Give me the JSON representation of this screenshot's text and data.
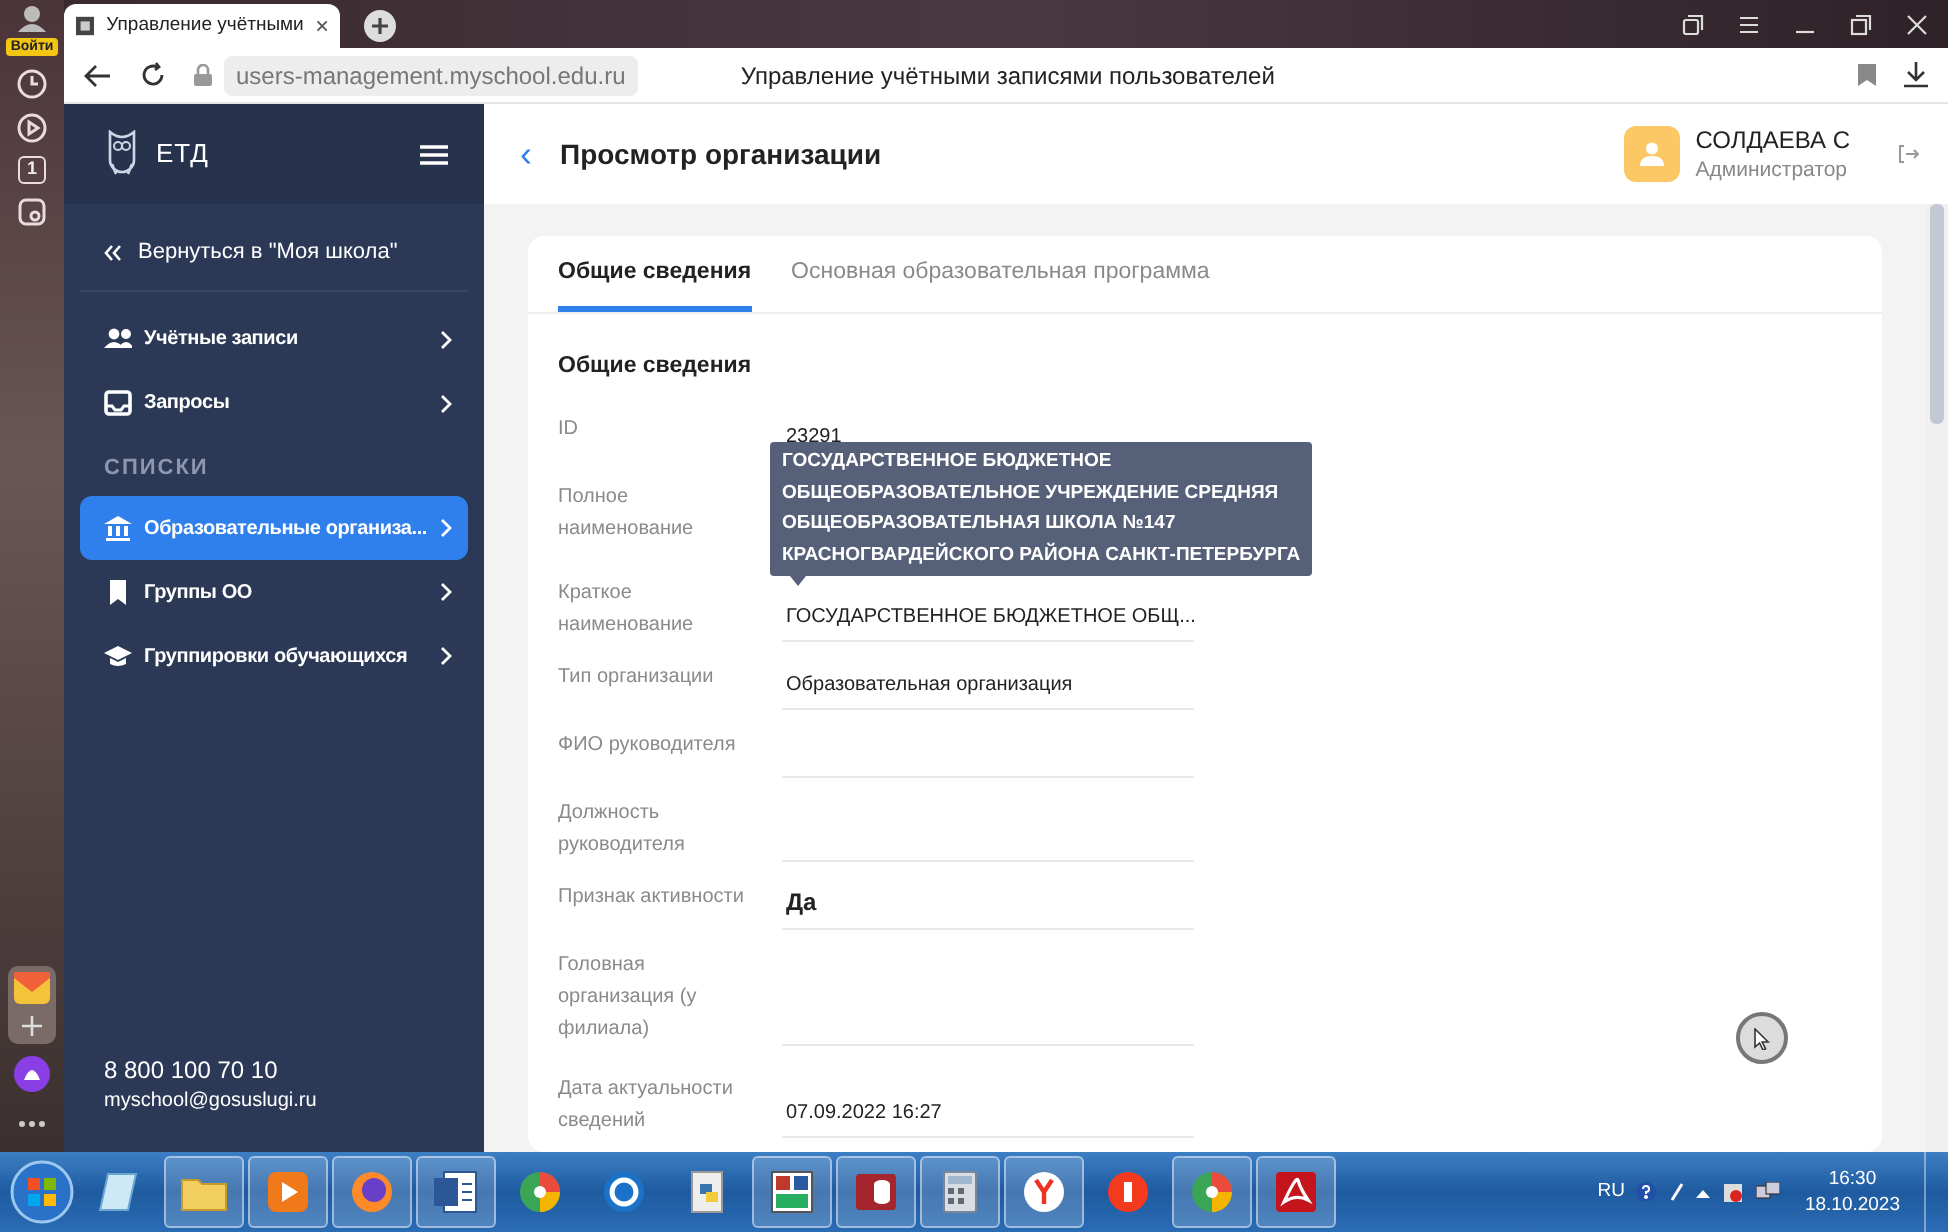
{
  "browser": {
    "login_label": "Войти",
    "badge_number": "1",
    "tab_title": "Управление учётными",
    "url": "users-management.myschool.edu.ru",
    "page_title": "Управление учётными записями пользователей"
  },
  "sidebar": {
    "logo": "ЕТД",
    "back_link": "Вернуться в \"Моя школа\"",
    "items": [
      {
        "label": "Учётные записи",
        "selected": false
      },
      {
        "label": "Запросы",
        "selected": false
      }
    ],
    "lists_section": {
      "title": "СПИСКИ",
      "items": [
        {
          "label": "Образовательные организа...",
          "selected": true
        },
        {
          "label": "Группы ОО",
          "selected": false
        },
        {
          "label": "Группировки обучающихся",
          "selected": false
        }
      ]
    },
    "phone": "8 800 100 70 10",
    "email": "myschool@gosuslugi.ru"
  },
  "header": {
    "back": "‹",
    "title": "Просмотр организации",
    "user_name": "СОЛДАЕВА С",
    "user_role": "Администратор"
  },
  "tabs": [
    {
      "label": "Общие сведения",
      "selected": true
    },
    {
      "label": "Основная образовательная программа",
      "selected": false
    }
  ],
  "section_title": "Общие сведения",
  "fields": [
    {
      "label": "ID",
      "value": "23291"
    },
    {
      "label": "Полное наименование"
    },
    {
      "label": "Краткое наименование",
      "value": "ГОСУДАРСТВЕННОЕ БЮДЖЕТНОЕ ОБЩ..."
    },
    {
      "label": "Тип организации",
      "value": "Образовательная организация"
    },
    {
      "label": "ФИО руководителя"
    },
    {
      "label": "Должность руководителя"
    },
    {
      "label": "Признак активности",
      "value": "Да"
    },
    {
      "label": "Головная организация (у филиала)"
    },
    {
      "label": "Дата актуальности сведений",
      "value": "07.09.2022 16:27"
    }
  ],
  "tooltip_lines": [
    "ГОСУДАРСТВЕННОЕ БЮДЖЕТНОЕ",
    "ОБЩЕОБРАЗОВАТЕЛЬНОЕ УЧРЕЖДЕНИЕ СРЕДНЯЯ",
    "ОБЩЕОБРАЗОВАТЕЛЬНАЯ ШКОЛА №147",
    "КРАСНОГВАРДЕЙСКОГО РАЙОНА САНКТ-ПЕТЕРБУРГА"
  ],
  "taskbar": {
    "language": "RU",
    "time": "16:30",
    "date": "18.10.2023"
  }
}
